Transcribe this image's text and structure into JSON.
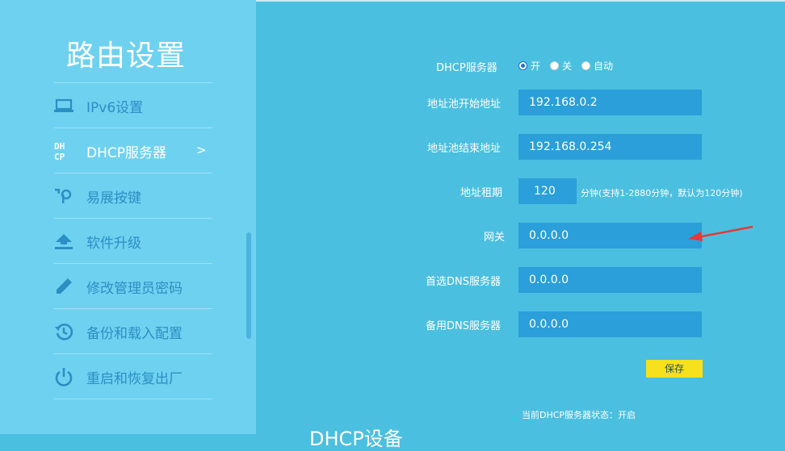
{
  "sidebar": {
    "title": "路由设置",
    "items": [
      {
        "label": "IPv6设置",
        "icon": "laptop-icon"
      },
      {
        "label": "DHCP服务器",
        "icon": "dhcp-icon",
        "icon_text_top": "DH",
        "icon_text_bottom": "CP",
        "active": true,
        "arrow": ">"
      },
      {
        "label": "易展按键",
        "icon": "easymesh-key-icon"
      },
      {
        "label": "软件升级",
        "icon": "upload-icon"
      },
      {
        "label": "修改管理员密码",
        "icon": "pencil-icon"
      },
      {
        "label": "备份和载入配置",
        "icon": "history-icon"
      },
      {
        "label": "重启和恢复出厂",
        "icon": "power-icon"
      }
    ]
  },
  "form": {
    "dhcp_server": {
      "label": "DHCP服务器",
      "options": [
        "开",
        "关",
        "自动"
      ],
      "selected": "开"
    },
    "pool_start": {
      "label": "地址池开始地址",
      "value": "192.168.0.2"
    },
    "pool_end": {
      "label": "地址池结束地址",
      "value": "192.168.0.254"
    },
    "lease": {
      "label": "地址租期",
      "value": "120",
      "hint": "分钟(支持1-2880分钟，默认为120分钟)"
    },
    "gateway": {
      "label": "网关",
      "value": "0.0.0.0"
    },
    "primary_dns": {
      "label": "首选DNS服务器",
      "value": "0.0.0.0"
    },
    "secondary_dns": {
      "label": "备用DNS服务器",
      "value": "0.0.0.0"
    },
    "save_label": "保存",
    "status_text": "当前DHCP服务器状态：开启"
  },
  "section_heading": "DHCP设备",
  "colors": {
    "sidebar_bg": "#6fd1f0",
    "main_bg": "#4bbfe0",
    "field_bg": "#2b9fd9",
    "save_button": "#f6e11c",
    "annotation_arrow": "#e53935"
  }
}
